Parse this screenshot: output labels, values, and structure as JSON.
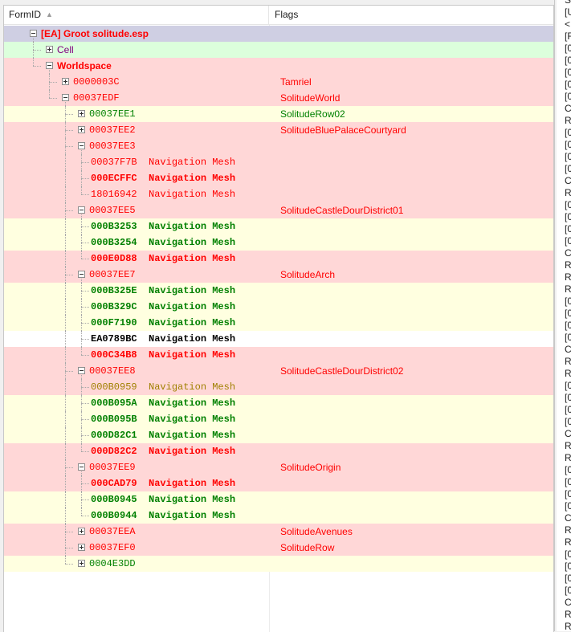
{
  "header": {
    "formid_label": "FormID",
    "flags_label": "Flags"
  },
  "colors": {
    "selected_bg": "#cfcfe3",
    "pink_bg": "#ffd7d7",
    "yellow_bg": "#ffffe0",
    "green_bg": "#dcffdc",
    "red_text": "#ff0000",
    "green_text": "#008000",
    "olive_text": "#a08000"
  },
  "rows": [
    {
      "id": "[EA] Groot solitude.esp",
      "flag": "",
      "bg": "sel",
      "color": "red",
      "bold": true,
      "font": "sans",
      "depth": 0,
      "expander": "minus"
    },
    {
      "id": "Cell",
      "flag": "",
      "bg": "green",
      "color": "purple",
      "bold": false,
      "font": "sans",
      "depth": 1,
      "expander": "plus"
    },
    {
      "id": "Worldspace",
      "flag": "",
      "bg": "pink",
      "color": "red",
      "bold": true,
      "font": "sans",
      "depth": 1,
      "expander": "minus"
    },
    {
      "id": "0000003C",
      "flag": "Tamriel",
      "bg": "pink",
      "color": "red",
      "bold": false,
      "font": "mono",
      "depth": 2,
      "expander": "plus"
    },
    {
      "id": "00037EDF",
      "flag": "SolitudeWorld",
      "bg": "pink",
      "color": "red",
      "bold": false,
      "font": "mono",
      "depth": 2,
      "expander": "minus"
    },
    {
      "id": "00037EE1",
      "flag": "SolitudeRow02",
      "bg": "yel",
      "color": "green",
      "bold": false,
      "font": "mono",
      "depth": 3,
      "expander": "plus"
    },
    {
      "id": "00037EE2",
      "flag": "SolitudeBluePalaceCourtyard",
      "bg": "pink",
      "color": "red",
      "bold": false,
      "font": "mono",
      "depth": 3,
      "expander": "plus"
    },
    {
      "id": "00037EE3",
      "flag": "",
      "bg": "pink",
      "color": "red",
      "bold": false,
      "font": "mono",
      "depth": 3,
      "expander": "minus"
    },
    {
      "id": "00037F7B  Navigation Mesh",
      "flag": "",
      "bg": "pink",
      "color": "red",
      "bold": false,
      "font": "mono",
      "depth": 4,
      "expander": "none"
    },
    {
      "id": "000ECFFC  Navigation Mesh",
      "flag": "",
      "bg": "pink",
      "color": "red",
      "bold": true,
      "font": "mono",
      "depth": 4,
      "expander": "none"
    },
    {
      "id": "18016942  Navigation Mesh",
      "flag": "",
      "bg": "pink",
      "color": "red",
      "bold": false,
      "font": "mono",
      "depth": 4,
      "expander": "none"
    },
    {
      "id": "00037EE5",
      "flag": "SolitudeCastleDourDistrict01",
      "bg": "pink",
      "color": "red",
      "bold": false,
      "font": "mono",
      "depth": 3,
      "expander": "minus"
    },
    {
      "id": "000B3253  Navigation Mesh",
      "flag": "",
      "bg": "yel",
      "color": "green",
      "bold": true,
      "font": "mono",
      "depth": 4,
      "expander": "none"
    },
    {
      "id": "000B3254  Navigation Mesh",
      "flag": "",
      "bg": "yel",
      "color": "green",
      "bold": true,
      "font": "mono",
      "depth": 4,
      "expander": "none"
    },
    {
      "id": "000E0D88  Navigation Mesh",
      "flag": "",
      "bg": "pink",
      "color": "red",
      "bold": true,
      "font": "mono",
      "depth": 4,
      "expander": "none"
    },
    {
      "id": "00037EE7",
      "flag": "SolitudeArch",
      "bg": "pink",
      "color": "red",
      "bold": false,
      "font": "mono",
      "depth": 3,
      "expander": "minus"
    },
    {
      "id": "000B325E  Navigation Mesh",
      "flag": "",
      "bg": "yel",
      "color": "green",
      "bold": true,
      "font": "mono",
      "depth": 4,
      "expander": "none"
    },
    {
      "id": "000B329C  Navigation Mesh",
      "flag": "",
      "bg": "yel",
      "color": "green",
      "bold": true,
      "font": "mono",
      "depth": 4,
      "expander": "none"
    },
    {
      "id": "000F7190  Navigation Mesh",
      "flag": "",
      "bg": "yel",
      "color": "green",
      "bold": true,
      "font": "mono",
      "depth": 4,
      "expander": "none"
    },
    {
      "id": "EA0789BC  Navigation Mesh",
      "flag": "",
      "bg": "white",
      "color": "black",
      "bold": true,
      "font": "mono",
      "depth": 4,
      "expander": "none"
    },
    {
      "id": "000C34B8  Navigation Mesh",
      "flag": "",
      "bg": "pink",
      "color": "red",
      "bold": true,
      "font": "mono",
      "depth": 4,
      "expander": "none"
    },
    {
      "id": "00037EE8",
      "flag": "SolitudeCastleDourDistrict02",
      "bg": "pink",
      "color": "red",
      "bold": false,
      "font": "mono",
      "depth": 3,
      "expander": "minus"
    },
    {
      "id": "000B0959  Navigation Mesh",
      "flag": "",
      "bg": "pink",
      "color": "olive",
      "bold": false,
      "font": "mono",
      "depth": 4,
      "expander": "none"
    },
    {
      "id": "000B095A  Navigation Mesh",
      "flag": "",
      "bg": "yel",
      "color": "green",
      "bold": true,
      "font": "mono",
      "depth": 4,
      "expander": "none"
    },
    {
      "id": "000B095B  Navigation Mesh",
      "flag": "",
      "bg": "yel",
      "color": "green",
      "bold": true,
      "font": "mono",
      "depth": 4,
      "expander": "none"
    },
    {
      "id": "000D82C1  Navigation Mesh",
      "flag": "",
      "bg": "yel",
      "color": "green",
      "bold": true,
      "font": "mono",
      "depth": 4,
      "expander": "none"
    },
    {
      "id": "000D82C2  Navigation Mesh",
      "flag": "",
      "bg": "pink",
      "color": "red",
      "bold": true,
      "font": "mono",
      "depth": 4,
      "expander": "none"
    },
    {
      "id": "00037EE9",
      "flag": "SolitudeOrigin",
      "bg": "pink",
      "color": "red",
      "bold": false,
      "font": "mono",
      "depth": 3,
      "expander": "minus"
    },
    {
      "id": "000CAD79  Navigation Mesh",
      "flag": "",
      "bg": "pink",
      "color": "red",
      "bold": true,
      "font": "mono",
      "depth": 4,
      "expander": "none"
    },
    {
      "id": "000B0945  Navigation Mesh",
      "flag": "",
      "bg": "yel",
      "color": "green",
      "bold": true,
      "font": "mono",
      "depth": 4,
      "expander": "none"
    },
    {
      "id": "000B0944  Navigation Mesh",
      "flag": "",
      "bg": "yel",
      "color": "green",
      "bold": true,
      "font": "mono",
      "depth": 4,
      "expander": "none"
    },
    {
      "id": "00037EEA",
      "flag": "SolitudeAvenues",
      "bg": "pink",
      "color": "red",
      "bold": false,
      "font": "mono",
      "depth": 3,
      "expander": "plus"
    },
    {
      "id": "00037EF0",
      "flag": "SolitudeRow",
      "bg": "pink",
      "color": "red",
      "bold": false,
      "font": "mono",
      "depth": 3,
      "expander": "plus"
    },
    {
      "id": "0004E3DD",
      "flag": "",
      "bg": "yel",
      "color": "green",
      "bold": false,
      "font": "mono",
      "depth": 3,
      "expander": "plus"
    }
  ],
  "side_panel": {
    "chars": [
      "S",
      "[U",
      "<",
      "[F",
      "[0",
      "[0",
      "[0",
      "[0",
      "[0",
      "C",
      "R",
      "[0",
      "[0",
      "[0",
      "[0",
      "C",
      "R",
      "[0",
      "[0",
      "[0",
      "[0",
      "C",
      "R",
      "R",
      "R",
      "[0",
      "[0",
      "[0",
      "[0",
      "C",
      "R",
      "R",
      "[0",
      "[0",
      "[0",
      "[0",
      "C",
      "R",
      "R",
      "[0",
      "[0",
      "[0",
      "[0",
      "C",
      "R",
      "R",
      "[0",
      "[0",
      "[0",
      "[0",
      "C",
      "R",
      "R",
      "[0",
      "[0"
    ]
  }
}
